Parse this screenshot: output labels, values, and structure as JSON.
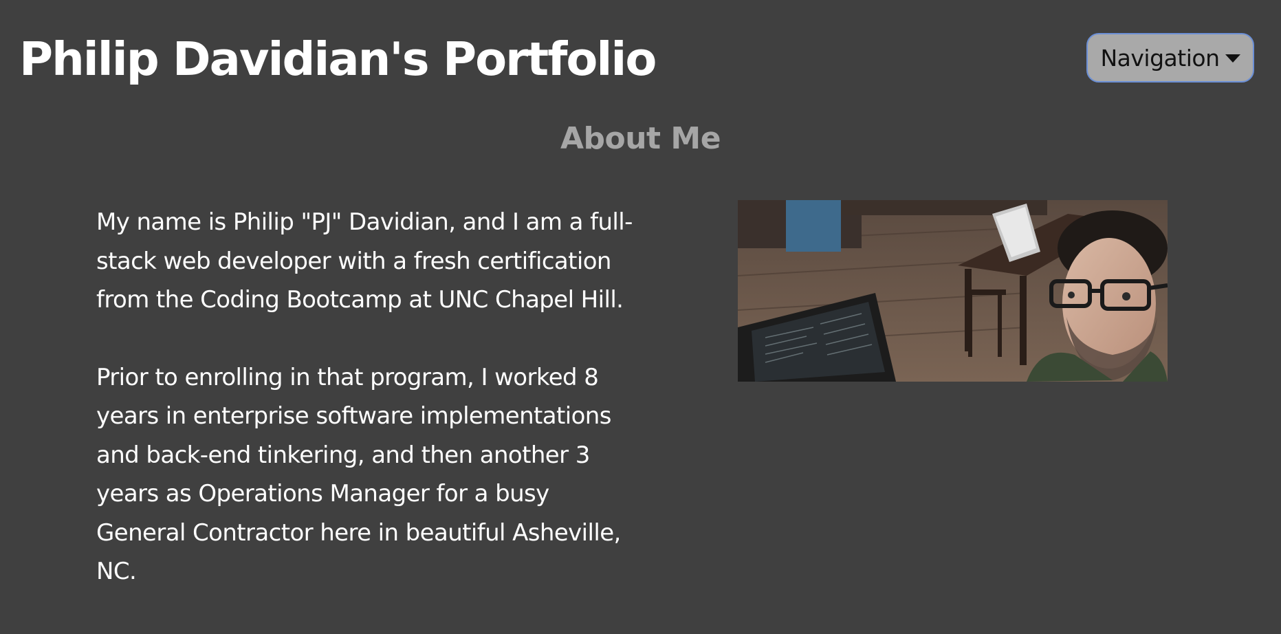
{
  "header": {
    "title": "Philip Davidian's Portfolio",
    "nav_label": "Navigation"
  },
  "about": {
    "heading": "About Me",
    "paragraphs": [
      "My name is Philip \"PJ\" Davidian, and I am a full-stack web developer with a fresh certification from the Coding Bootcamp at UNC Chapel Hill.",
      "Prior to enrolling in that program, I worked 8 years in enterprise software implementations and back-end tinkering, and then another 3 years as Operations Manager for a busy General Contractor here in beautiful Asheville, NC."
    ]
  },
  "colors": {
    "background": "#404040",
    "heading_text": "#ffffff",
    "section_heading": "#a6a6a6",
    "nav_button_bg": "#a9a9a9",
    "nav_button_border": "#6b8fd6"
  },
  "icons": {
    "nav_caret": "caret-down-icon"
  }
}
